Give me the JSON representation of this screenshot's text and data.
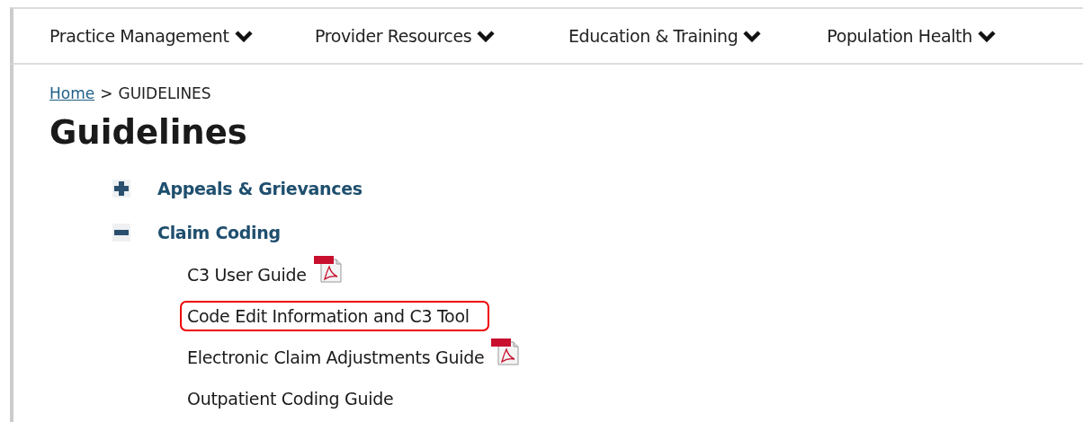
{
  "nav": [
    {
      "label": "Practice Management"
    },
    {
      "label": "Provider Resources"
    },
    {
      "label": "Education & Training"
    },
    {
      "label": "Population Health"
    }
  ],
  "breadcrumb": {
    "link": "Home",
    "separator": ">",
    "current": "GUIDELINES"
  },
  "heading": "Guidelines",
  "sections": [
    {
      "label": "Appeals & Grievances",
      "expanded": false
    },
    {
      "label": "Claim Coding",
      "expanded": true,
      "children": [
        {
          "label": "C3 User Guide",
          "pdf": true,
          "highlighted": false
        },
        {
          "label": "Code Edit Information and C3 Tool",
          "pdf": false,
          "highlighted": true
        },
        {
          "label": "Electronic Claim Adjustments Guide",
          "pdf": true,
          "highlighted": false
        },
        {
          "label": "Outpatient Coding Guide",
          "pdf": false,
          "highlighted": false
        }
      ]
    }
  ]
}
